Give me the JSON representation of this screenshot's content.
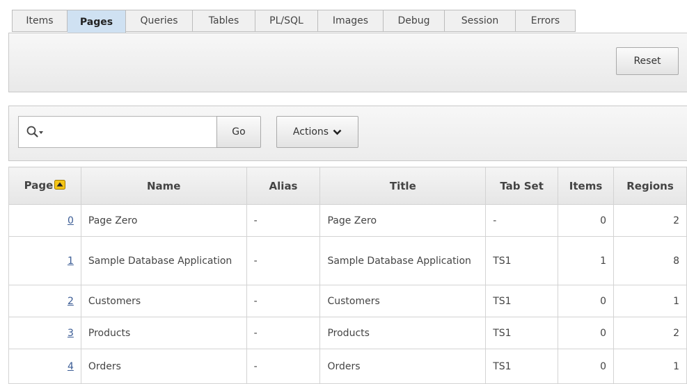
{
  "tabs": [
    "Items",
    "Pages",
    "Queries",
    "Tables",
    "PL/SQL",
    "Images",
    "Debug",
    "Session",
    "Errors"
  ],
  "active_tab": "Pages",
  "toolbar": {
    "reset_label": "Reset"
  },
  "search": {
    "value": "",
    "go_label": "Go",
    "actions_label": "Actions"
  },
  "table": {
    "headers": [
      "Page",
      "Name",
      "Alias",
      "Title",
      "Tab Set",
      "Items",
      "Regions"
    ],
    "sort": {
      "column": "Page",
      "direction": "ascending"
    },
    "rows": [
      {
        "page": "0",
        "name": "Page Zero",
        "alias": "-",
        "title": "Page Zero",
        "tabset": "-",
        "items": "0",
        "regions": "2"
      },
      {
        "page": "1",
        "name": "Sample Database Application",
        "alias": "-",
        "title": "Sample Database Application",
        "tabset": "TS1",
        "items": "1",
        "regions": "8"
      },
      {
        "page": "2",
        "name": "Customers",
        "alias": "-",
        "title": "Customers",
        "tabset": "TS1",
        "items": "0",
        "regions": "1"
      },
      {
        "page": "3",
        "name": "Products",
        "alias": "-",
        "title": "Products",
        "tabset": "TS1",
        "items": "0",
        "regions": "2"
      },
      {
        "page": "4",
        "name": "Orders",
        "alias": "-",
        "title": "Orders",
        "tabset": "TS1",
        "items": "0",
        "regions": "1"
      }
    ]
  },
  "colors": {
    "active_tab_bg": "#cfe1f2",
    "link": "#3a5b94",
    "sort_icon": "#f5c518"
  }
}
